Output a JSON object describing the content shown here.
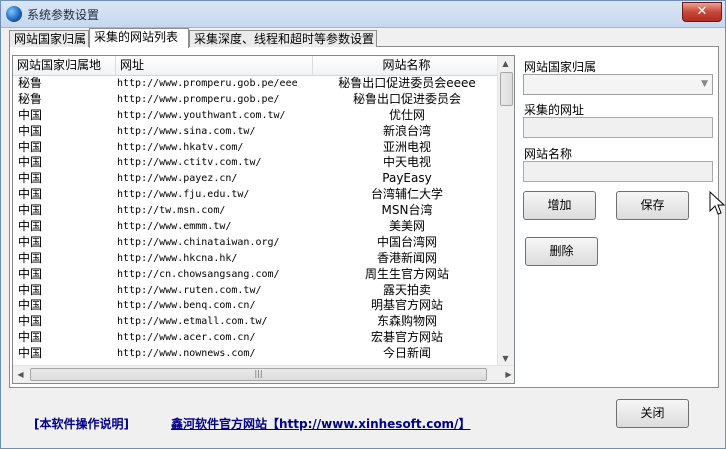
{
  "window": {
    "title": "系统参数设置",
    "close_label": "✕"
  },
  "tabs": [
    {
      "label": "网站国家归属"
    },
    {
      "label": "采集的网站列表"
    },
    {
      "label": "采集深度、线程和超时等参数设置"
    }
  ],
  "list": {
    "columns": [
      "网站国家归属地",
      "网址",
      "网站名称"
    ],
    "rows": [
      {
        "country": "秘鲁",
        "url": "http://www.promperu.gob.pe/eee",
        "name": "秘鲁出口促进委员会eeee"
      },
      {
        "country": "秘鲁",
        "url": "http://www.promperu.gob.pe/",
        "name": "秘鲁出口促进委员会"
      },
      {
        "country": "中国",
        "url": "http://www.youthwant.com.tw/",
        "name": "优仕网"
      },
      {
        "country": "中国",
        "url": "http://www.sina.com.tw/",
        "name": "新浪台湾"
      },
      {
        "country": "中国",
        "url": "http://www.hkatv.com/",
        "name": "亚洲电视"
      },
      {
        "country": "中国",
        "url": "http://www.ctitv.com.tw/",
        "name": "中天电视"
      },
      {
        "country": "中国",
        "url": "http://www.payez.cn/",
        "name": "PayEasy"
      },
      {
        "country": "中国",
        "url": "http://www.fju.edu.tw/",
        "name": "台湾辅仁大学"
      },
      {
        "country": "中国",
        "url": "http://tw.msn.com/",
        "name": "MSN台湾"
      },
      {
        "country": "中国",
        "url": "http://www.emmm.tw/",
        "name": "美美网"
      },
      {
        "country": "中国",
        "url": "http://www.chinataiwan.org/",
        "name": "中国台湾网"
      },
      {
        "country": "中国",
        "url": "http://www.hkcna.hk/",
        "name": "香港新闻网"
      },
      {
        "country": "中国",
        "url": "http://cn.chowsangsang.com/",
        "name": "周生生官方网站"
      },
      {
        "country": "中国",
        "url": "http://www.ruten.com.tw/",
        "name": "露天拍卖"
      },
      {
        "country": "中国",
        "url": "http://www.benq.com.cn/",
        "name": "明基官方网站"
      },
      {
        "country": "中国",
        "url": "http://www.etmall.com.tw/",
        "name": "东森购物网"
      },
      {
        "country": "中国",
        "url": "http://www.acer.com.cn/",
        "name": "宏碁官方网站"
      },
      {
        "country": "中国",
        "url": "http://www.nownews.com/",
        "name": "今日新闻"
      }
    ]
  },
  "form": {
    "country_label": "网站国家归属",
    "url_label": "采集的网址",
    "name_label": "网站名称",
    "add_label": "增加",
    "save_label": "保存",
    "delete_label": "删除"
  },
  "footer": {
    "help_link": "[本软件操作说明]",
    "site_link": "鑫河软件官方网站【http://www.xinhesoft.com/】",
    "close_label": "关闭"
  }
}
